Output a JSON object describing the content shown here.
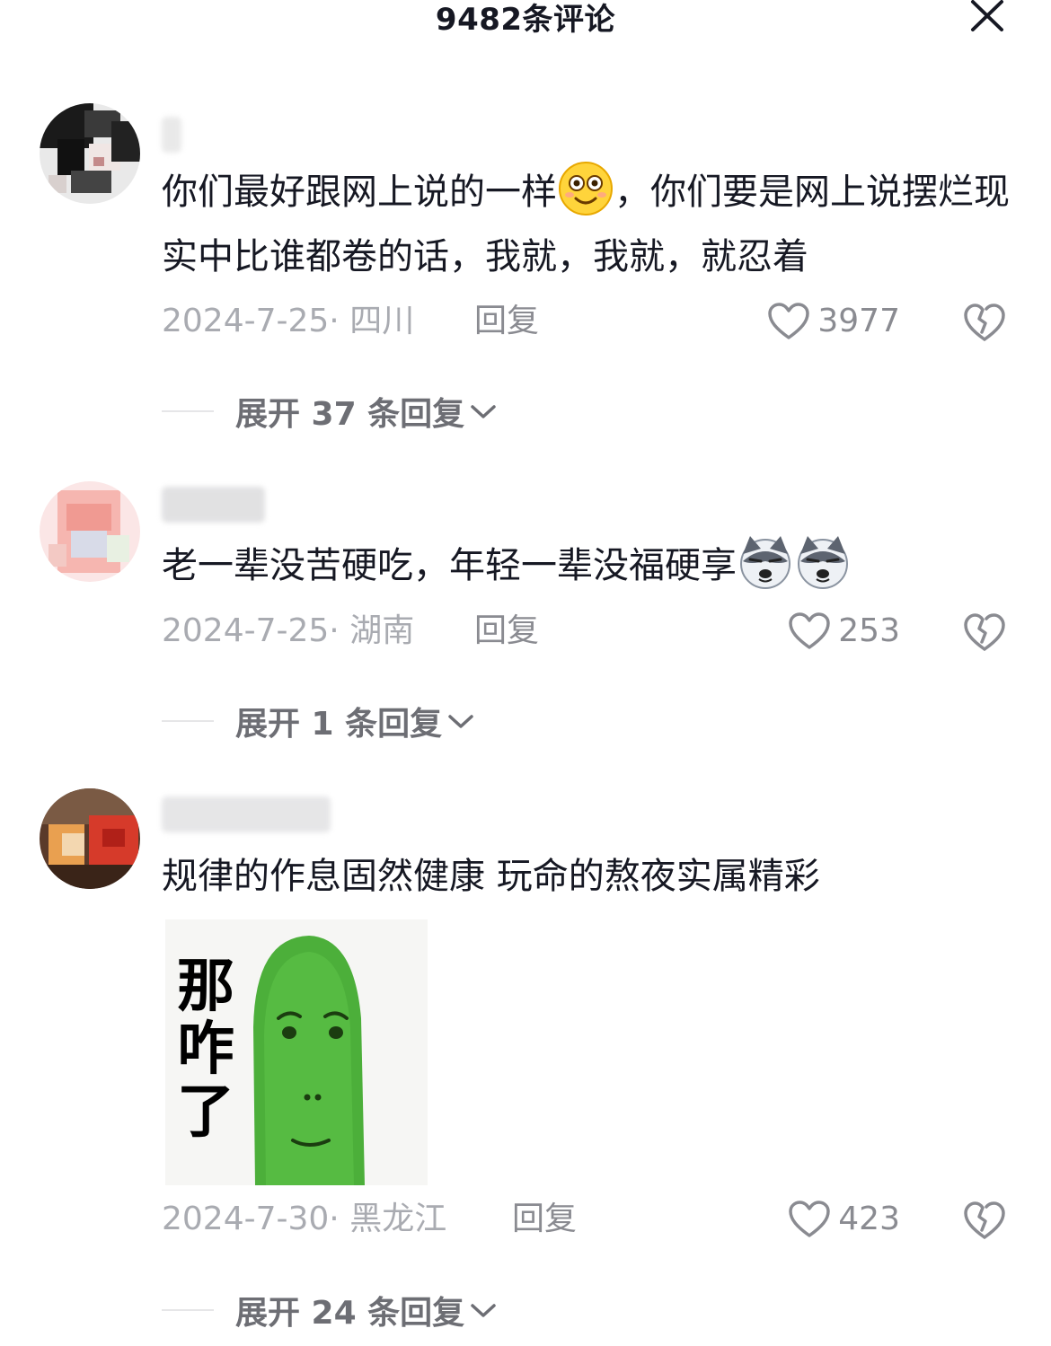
{
  "header": {
    "title": "9482条评论",
    "close_icon": "close-icon"
  },
  "comments": [
    {
      "text_before_emoji": "你们最好跟网上说的一样",
      "emoji": "smiley-face-emoji",
      "text_after_emoji": "，你们要是网上说摆烂现实中比谁都卷的话，我就，我就，就忍着",
      "date_location": "2024-7-25· 四川",
      "reply_label": "回复",
      "likes": "3977",
      "expand_label": "展开 37 条回复"
    },
    {
      "text_before_emoji": "老一辈没苦硬吃，年轻一辈没福硬享",
      "emoji": "husky-dog-emoji",
      "text_after_emoji": "",
      "date_location": "2024-7-25· 湖南",
      "reply_label": "回复",
      "likes": "253",
      "expand_label": "展开 1 条回复"
    },
    {
      "text_before_emoji": "规律的作息固然健康 玩命的熬夜实属精彩",
      "emoji": "",
      "text_after_emoji": "",
      "sticker_text": "那咋了",
      "date_location": "2024-7-30· 黑龙江",
      "reply_label": "回复",
      "likes": "423",
      "expand_label": "展开 24 条回复"
    }
  ],
  "colors": {
    "primary_text": "#161823",
    "secondary_text": "#a9abb1",
    "action_text": "#8a8b91",
    "expand_text": "#6d6e74",
    "sticker_green": "#4caf3a"
  }
}
